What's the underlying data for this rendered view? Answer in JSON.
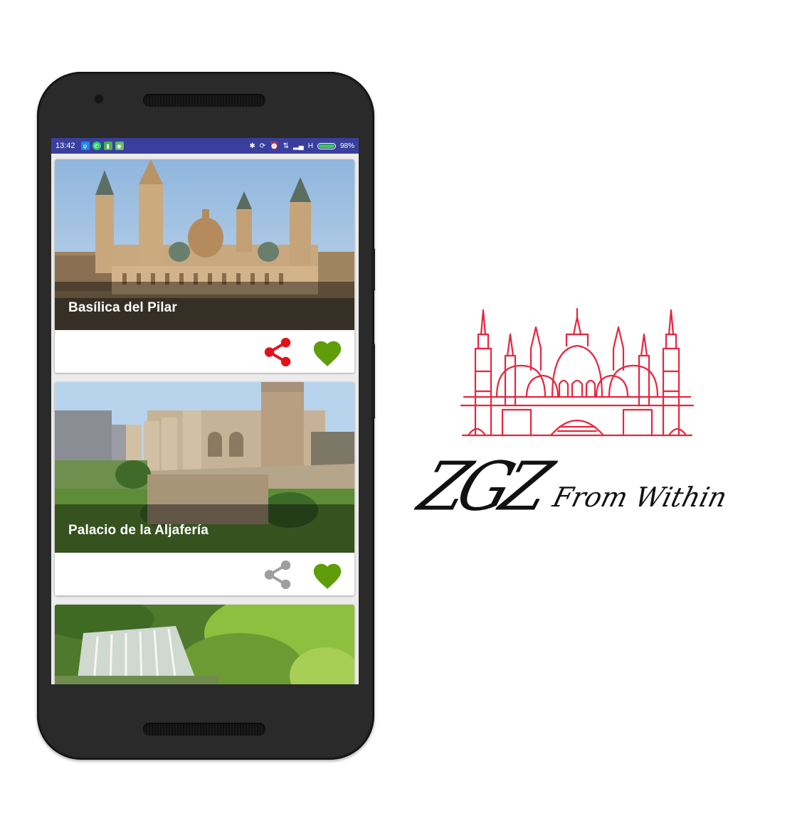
{
  "status_bar": {
    "time": "13:42",
    "network": "H",
    "battery": "98%",
    "battery_level": 0.98,
    "color": "#3a3f9e"
  },
  "places": [
    {
      "title": "Basílica del Pilar",
      "share_color": "#e0131b",
      "share_active": true,
      "favorite_color": "#5f9e0a",
      "favorite": true
    },
    {
      "title": "Palacio de la Aljafería",
      "share_color": "#9e9e9e",
      "share_active": false,
      "favorite_color": "#5f9e0a",
      "favorite": true
    },
    {
      "title": "",
      "share_color": "#9e9e9e",
      "share_active": false,
      "favorite_color": "#5f9e0a",
      "favorite": false
    }
  ],
  "brand": {
    "logo_big": "ZGZ",
    "logo_small": "From Within",
    "logo_color": "#e8253d",
    "icons": [
      "share-icon",
      "heart-icon",
      "basilica-logo-icon"
    ]
  }
}
